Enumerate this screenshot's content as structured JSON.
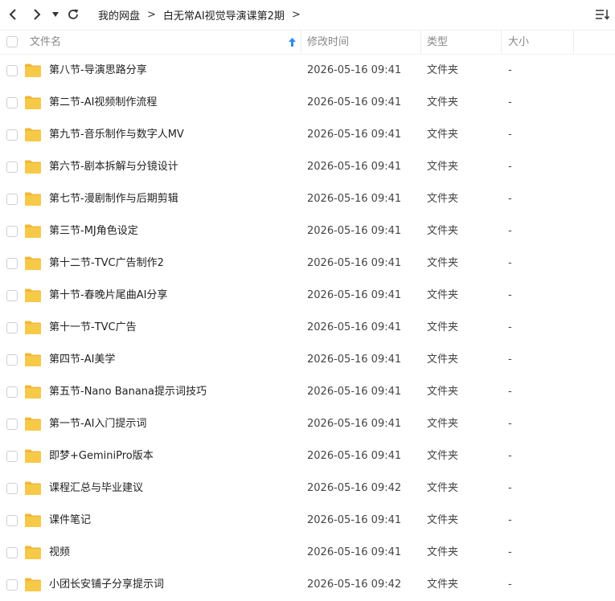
{
  "breadcrumb": {
    "root": "我的网盘",
    "separator": ">",
    "current": "白无常AI视觉导演课第2期",
    "trailing_separator": ">"
  },
  "icons": {
    "back": "chevron-left-icon",
    "forward": "chevron-right-icon",
    "history": "dropdown-triangle-icon",
    "refresh": "refresh-icon",
    "sort_toggle": "sort-list-icon",
    "sort_direction": "arrow-up-icon",
    "folder": "folder-icon"
  },
  "colors": {
    "folder": "#F7C948",
    "sort_arrow": "#2f8bf2"
  },
  "columns": {
    "name": "文件名",
    "modified": "修改时间",
    "type": "类型",
    "size": "大小"
  },
  "files": [
    {
      "name": "第八节-导演思路分享",
      "modified": "2026-05-16 09:41",
      "type": "文件夹",
      "size": "-"
    },
    {
      "name": "第二节-AI视频制作流程",
      "modified": "2026-05-16 09:41",
      "type": "文件夹",
      "size": "-"
    },
    {
      "name": "第九节-音乐制作与数字人MV",
      "modified": "2026-05-16 09:41",
      "type": "文件夹",
      "size": "-"
    },
    {
      "name": "第六节-剧本拆解与分镜设计",
      "modified": "2026-05-16 09:41",
      "type": "文件夹",
      "size": "-"
    },
    {
      "name": "第七节-漫剧制作与后期剪辑",
      "modified": "2026-05-16 09:41",
      "type": "文件夹",
      "size": "-"
    },
    {
      "name": "第三节-MJ角色设定",
      "modified": "2026-05-16 09:41",
      "type": "文件夹",
      "size": "-"
    },
    {
      "name": "第十二节-TVC广告制作2",
      "modified": "2026-05-16 09:41",
      "type": "文件夹",
      "size": "-"
    },
    {
      "name": "第十节-春晚片尾曲AI分享",
      "modified": "2026-05-16 09:41",
      "type": "文件夹",
      "size": "-"
    },
    {
      "name": "第十一节-TVC广告",
      "modified": "2026-05-16 09:41",
      "type": "文件夹",
      "size": "-"
    },
    {
      "name": "第四节-AI美学",
      "modified": "2026-05-16 09:41",
      "type": "文件夹",
      "size": "-"
    },
    {
      "name": "第五节-Nano Banana提示词技巧",
      "modified": "2026-05-16 09:41",
      "type": "文件夹",
      "size": "-"
    },
    {
      "name": "第一节-AI入门提示词",
      "modified": "2026-05-16 09:41",
      "type": "文件夹",
      "size": "-"
    },
    {
      "name": "即梦+GeminiPro版本",
      "modified": "2026-05-16 09:41",
      "type": "文件夹",
      "size": "-"
    },
    {
      "name": "课程汇总与毕业建议",
      "modified": "2026-05-16 09:42",
      "type": "文件夹",
      "size": "-"
    },
    {
      "name": "课件笔记",
      "modified": "2026-05-16 09:41",
      "type": "文件夹",
      "size": "-"
    },
    {
      "name": "视频",
      "modified": "2026-05-16 09:41",
      "type": "文件夹",
      "size": "-"
    },
    {
      "name": "小团长安铺子分享提示词",
      "modified": "2026-05-16 09:42",
      "type": "文件夹",
      "size": "-"
    }
  ]
}
